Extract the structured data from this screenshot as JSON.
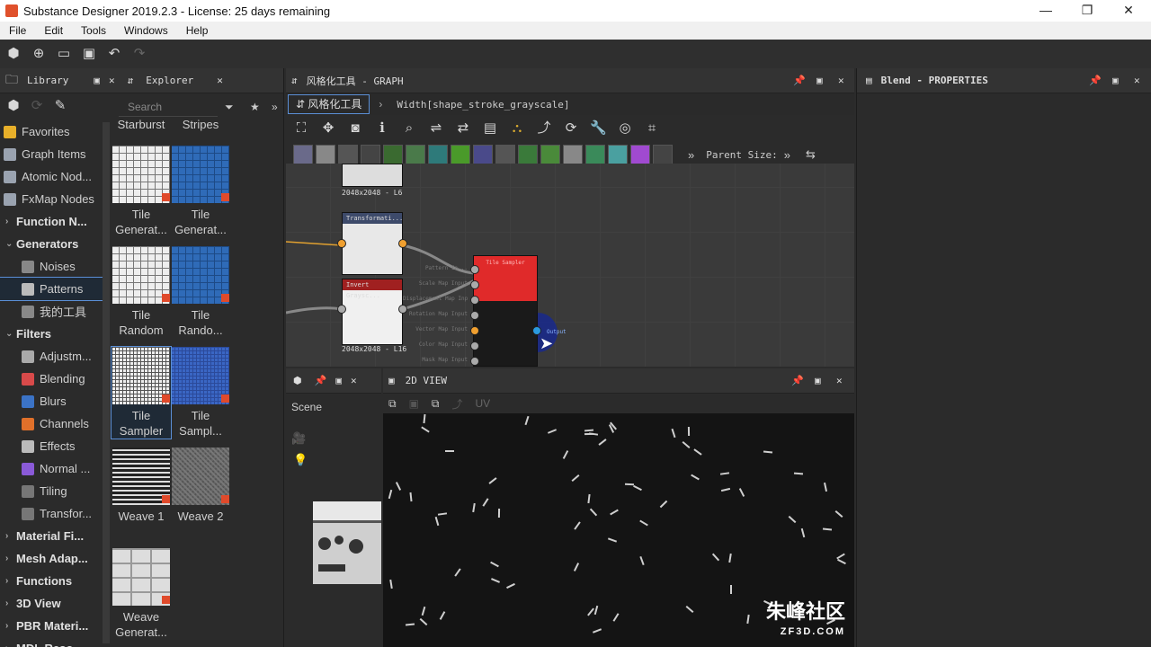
{
  "window": {
    "title": "Substance Designer 2019.2.3 - License: 25 days remaining",
    "minimize": "—",
    "restore": "❐",
    "close": "✕"
  },
  "menu": [
    "File",
    "Edit",
    "Tools",
    "Windows",
    "Help"
  ],
  "library": {
    "tab_label": "Library",
    "explorer_label": "Explorer",
    "search_placeholder": "Search",
    "tree": [
      {
        "label": "Favorites",
        "kind": "item",
        "color": "#e8b02a"
      },
      {
        "label": "Graph Items",
        "kind": "item",
        "color": "#9aa3b0"
      },
      {
        "label": "Atomic Nod...",
        "kind": "item",
        "color": "#9aa3b0"
      },
      {
        "label": "FxMap Nodes",
        "kind": "item",
        "color": "#9aa3b0"
      },
      {
        "label": "Function N...",
        "kind": "cat",
        "arrow": "›"
      },
      {
        "label": "Generators",
        "kind": "cat",
        "arrow": "⌄"
      },
      {
        "label": "Noises",
        "kind": "sub",
        "color": "#888"
      },
      {
        "label": "Patterns",
        "kind": "sub",
        "color": "#bbb",
        "selected": true
      },
      {
        "label": "我的工具",
        "kind": "sub",
        "color": "#888"
      },
      {
        "label": "Filters",
        "kind": "cat",
        "arrow": "⌄"
      },
      {
        "label": "Adjustm...",
        "kind": "sub",
        "color": "#aaa"
      },
      {
        "label": "Blending",
        "kind": "sub",
        "color": "#d84a4a"
      },
      {
        "label": "Blurs",
        "kind": "sub",
        "color": "#3b73c6"
      },
      {
        "label": "Channels",
        "kind": "sub",
        "color": "#e0702a"
      },
      {
        "label": "Effects",
        "kind": "sub",
        "color": "#bbb"
      },
      {
        "label": "Normal ...",
        "kind": "sub",
        "color": "#8a5ad8"
      },
      {
        "label": "Tiling",
        "kind": "sub",
        "color": "#777"
      },
      {
        "label": "Transfor...",
        "kind": "sub",
        "color": "#777"
      },
      {
        "label": "Material Fi...",
        "kind": "cat",
        "arrow": "›"
      },
      {
        "label": "Mesh Adap...",
        "kind": "cat",
        "arrow": "›"
      },
      {
        "label": "Functions",
        "kind": "cat",
        "arrow": "›"
      },
      {
        "label": "3D View",
        "kind": "cat",
        "arrow": "›"
      },
      {
        "label": "PBR Materi...",
        "kind": "cat",
        "arrow": "›"
      },
      {
        "label": "MDL Reso...",
        "kind": "cat",
        "arrow": "›"
      }
    ],
    "grid_header": [
      "Starburst",
      "Stripes"
    ],
    "grid": [
      {
        "label": "Tile\nGenerat...",
        "pattern": "pat-white"
      },
      {
        "label": "Tile\nGenerat...",
        "pattern": "pat-blue"
      },
      {
        "label": "Tile\nRandom",
        "pattern": "pat-white"
      },
      {
        "label": "Tile\nRando...",
        "pattern": "pat-blue"
      },
      {
        "label": "Tile\nSampler",
        "pattern": "pat-dense",
        "selected": true
      },
      {
        "label": "Tile\nSampl...",
        "pattern": "pat-dense-blue"
      },
      {
        "label": "Weave 1",
        "pattern": "pat-weave"
      },
      {
        "label": "Weave 2",
        "pattern": "pat-weave2"
      },
      {
        "label": "Weave\nGenerat...",
        "pattern": "pat-weavegen"
      }
    ]
  },
  "graph": {
    "title": "风格化工具 - GRAPH",
    "tab_label": "风格化工具",
    "breadcrumb": "Width[shape_stroke_grayscale]",
    "parent_size_label": "Parent Size:",
    "nodes": {
      "top_node_caption": "2048x2048 - L6",
      "transform_label": "Transformati...",
      "invert_label": "Invert Graysc...",
      "mid_caption": "2048x2048 - L16",
      "sampler_label": "Tile Sampler",
      "sampler_inputs": [
        "Pattern In...",
        "Scale Map Input",
        "Displacement Map Input",
        "Rotation Map Input",
        "Vector Map Input",
        "Color Map Input",
        "Mask Map Input"
      ],
      "output_label": "Output"
    }
  },
  "properties": {
    "title": "Blend - PROPERTIES"
  },
  "view3d": {
    "scene_label": "Scene"
  },
  "view2d": {
    "title": "2D VIEW",
    "uv_label": "UV"
  },
  "watermark": {
    "main": "朱峰社区",
    "sub": "ZF3D.COM"
  }
}
